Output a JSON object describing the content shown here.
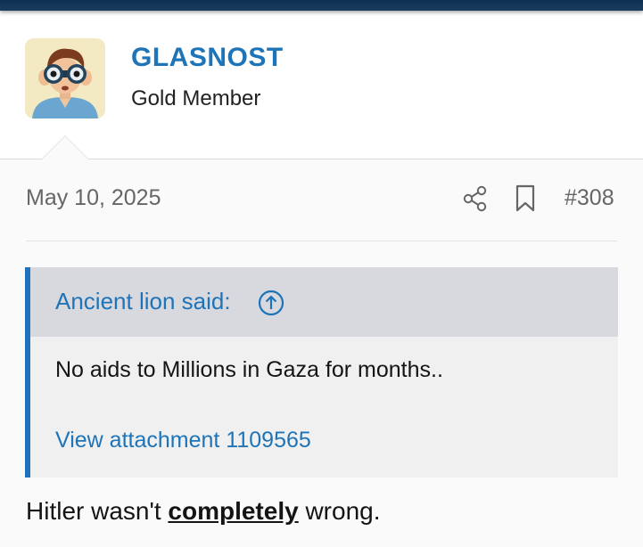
{
  "user": {
    "name": "GLASNOST",
    "title": "Gold Member",
    "avatar_icon": "man-with-binoculars-avatar"
  },
  "post": {
    "date": "May 10, 2025",
    "number": "#308",
    "share_icon": "share-icon",
    "bookmark_icon": "bookmark-icon"
  },
  "quote": {
    "author": "Ancient lion said:",
    "text": "No aids to Millions in Gaza for months..",
    "attachment_link": "View attachment 1109565"
  },
  "message": {
    "before": "Hitler wasn't ",
    "emphasis": "completely",
    "after": " wrong."
  },
  "colors": {
    "link": "#1d74b8",
    "quote_border": "#1f73bd",
    "top_bar": "#0c2f52"
  }
}
